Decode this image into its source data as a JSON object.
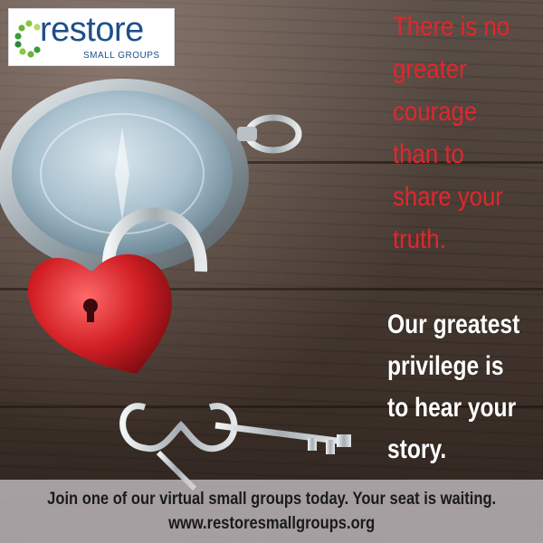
{
  "logo": {
    "brand": "restore",
    "subtitle": "SMALL GROUPS",
    "icon": "dot-circle-icon"
  },
  "quote_red": {
    "lines": [
      "There is no",
      "greater",
      "courage",
      "than to",
      "share your",
      "truth."
    ],
    "color": "#e2262e"
  },
  "quote_white": {
    "lines": [
      "Our greatest",
      "privilege is",
      "to hear your",
      "story."
    ],
    "color": "#ffffff"
  },
  "banner": {
    "message": "Join one of our virtual small groups today. Your seat is waiting.",
    "url": "www.restoresmallgroups.org"
  },
  "photo": {
    "subject": "compass-heart-padlock-keys-photo"
  }
}
